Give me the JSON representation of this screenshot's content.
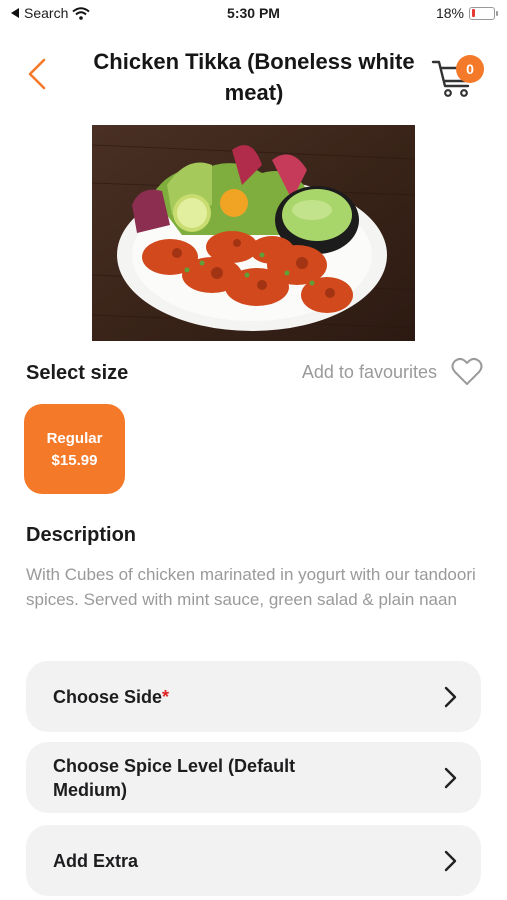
{
  "status": {
    "back_app": "Search",
    "time": "5:30 PM",
    "battery": "18%",
    "battery_level": 0.18,
    "battery_color": "#e53935"
  },
  "header": {
    "title": "Chicken Tikka (Boneless white meat)",
    "cart_count": "0"
  },
  "product": {
    "image_desc_icon": "food-photo"
  },
  "size": {
    "section_label": "Select size",
    "favourites_label": "Add to favourites",
    "options": [
      {
        "name": "Regular",
        "price": "$15.99",
        "selected": true
      }
    ]
  },
  "description": {
    "title": "Description",
    "text": "With Cubes of chicken marinated in yogurt with our tandoori spices. Served with mint sauce, green salad & plain naan"
  },
  "options": [
    {
      "label": "Choose Side",
      "required": true,
      "required_mark": "*"
    },
    {
      "label": "Choose Spice Level (Default Medium)",
      "required": false
    },
    {
      "label": "Add Extra",
      "required": false
    }
  ],
  "colors": {
    "accent": "#f47a2a",
    "required": "#e02020",
    "muted_text": "#9a9a9a",
    "option_bg": "#f2f2f2"
  }
}
